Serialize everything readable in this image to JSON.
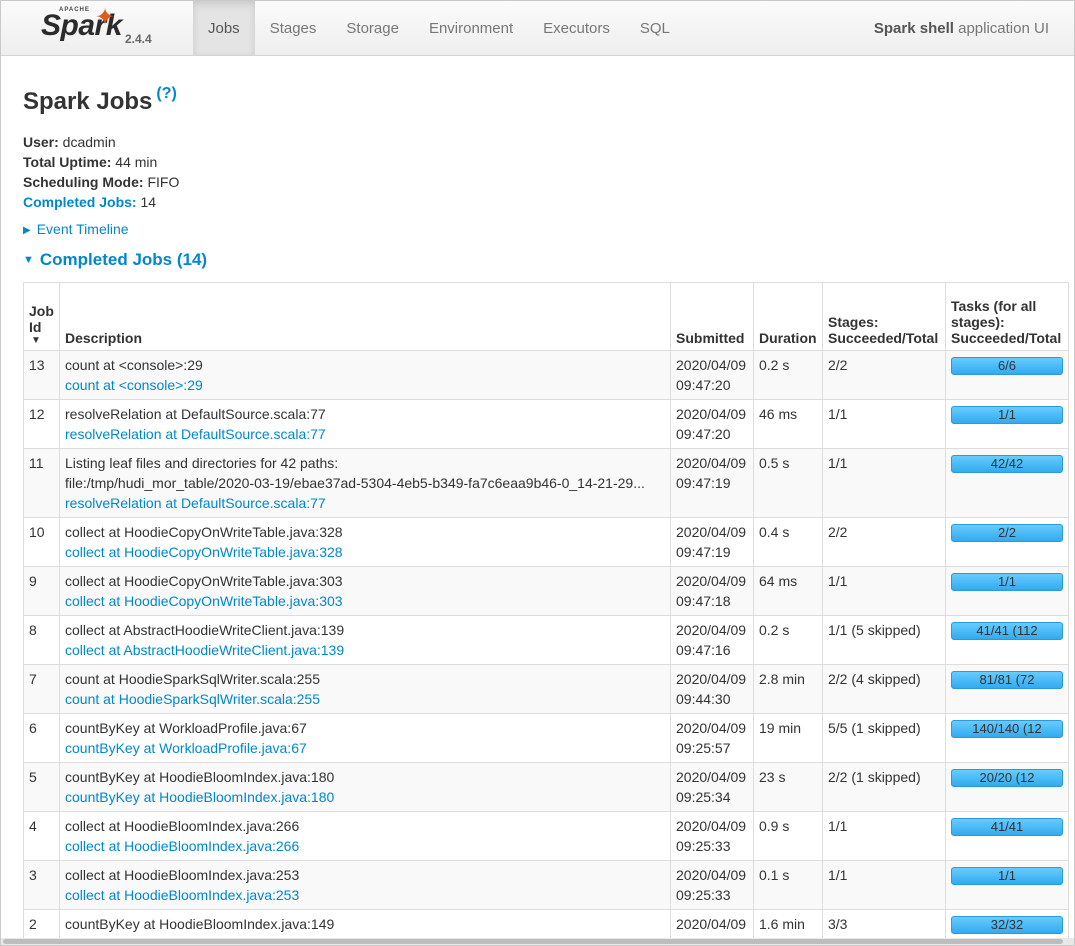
{
  "brand": {
    "apache": "APACHE",
    "name": "Spark",
    "version": "2.4.4"
  },
  "nav": {
    "tabs": [
      {
        "label": "Jobs",
        "active": true
      },
      {
        "label": "Stages",
        "active": false
      },
      {
        "label": "Storage",
        "active": false
      },
      {
        "label": "Environment",
        "active": false
      },
      {
        "label": "Executors",
        "active": false
      },
      {
        "label": "SQL",
        "active": false
      }
    ],
    "app_name_bold": "Spark shell",
    "app_name_rest": " application UI"
  },
  "page": {
    "title": "Spark Jobs",
    "help": "(?)",
    "user_label": "User:",
    "user": " dcadmin",
    "uptime_label": "Total Uptime:",
    "uptime": " 44 min",
    "mode_label": "Scheduling Mode:",
    "mode": " FIFO",
    "completed_label": "Completed Jobs:",
    "completed": " 14",
    "event_timeline": "Event Timeline",
    "completed_heading": "Completed Jobs (14)"
  },
  "table": {
    "headers": {
      "job_id": "Job Id",
      "description": "Description",
      "submitted": "Submitted",
      "duration": "Duration",
      "stages": "Stages: Succeeded/Total",
      "tasks": "Tasks (for all stages): Succeeded/Total"
    },
    "rows": [
      {
        "id": "13",
        "desc": "count at <console>:29",
        "link": "count at <console>:29",
        "submitted": "2020/04/09 09:47:20",
        "duration": "0.2 s",
        "stages": "2/2",
        "tasks": "6/6",
        "progress": 1.0
      },
      {
        "id": "12",
        "desc": "resolveRelation at DefaultSource.scala:77",
        "link": "resolveRelation at DefaultSource.scala:77",
        "submitted": "2020/04/09 09:47:20",
        "duration": "46 ms",
        "stages": "1/1",
        "tasks": "1/1",
        "progress": 1.0
      },
      {
        "id": "11",
        "desc": "Listing leaf files and directories for 42 paths:",
        "desc2": "file:/tmp/hudi_mor_table/2020-03-19/ebae37ad-5304-4eb5-b349-fa7c6eaa9b46-0_14-21-29...",
        "link": "resolveRelation at DefaultSource.scala:77",
        "submitted": "2020/04/09 09:47:19",
        "duration": "0.5 s",
        "stages": "1/1",
        "tasks": "42/42",
        "progress": 1.0
      },
      {
        "id": "10",
        "desc": "collect at HoodieCopyOnWriteTable.java:328",
        "link": "collect at HoodieCopyOnWriteTable.java:328",
        "submitted": "2020/04/09 09:47:19",
        "duration": "0.4 s",
        "stages": "2/2",
        "tasks": "2/2",
        "progress": 1.0
      },
      {
        "id": "9",
        "desc": "collect at HoodieCopyOnWriteTable.java:303",
        "link": "collect at HoodieCopyOnWriteTable.java:303",
        "submitted": "2020/04/09 09:47:18",
        "duration": "64 ms",
        "stages": "1/1",
        "tasks": "1/1",
        "progress": 1.0
      },
      {
        "id": "8",
        "desc": "collect at AbstractHoodieWriteClient.java:139",
        "link": "collect at AbstractHoodieWriteClient.java:139",
        "submitted": "2020/04/09 09:47:16",
        "duration": "0.2 s",
        "stages": "1/1 (5 skipped)",
        "tasks": "41/41 (112",
        "progress": 1.0
      },
      {
        "id": "7",
        "desc": "count at HoodieSparkSqlWriter.scala:255",
        "link": "count at HoodieSparkSqlWriter.scala:255",
        "submitted": "2020/04/09 09:44:30",
        "duration": "2.8 min",
        "stages": "2/2 (4 skipped)",
        "tasks": "81/81 (72",
        "progress": 1.0
      },
      {
        "id": "6",
        "desc": "countByKey at WorkloadProfile.java:67",
        "link": "countByKey at WorkloadProfile.java:67",
        "submitted": "2020/04/09 09:25:57",
        "duration": "19 min",
        "stages": "5/5 (1 skipped)",
        "tasks": "140/140 (12",
        "progress": 1.0
      },
      {
        "id": "5",
        "desc": "countByKey at HoodieBloomIndex.java:180",
        "link": "countByKey at HoodieBloomIndex.java:180",
        "submitted": "2020/04/09 09:25:34",
        "duration": "23 s",
        "stages": "2/2 (1 skipped)",
        "tasks": "20/20 (12",
        "progress": 1.0
      },
      {
        "id": "4",
        "desc": "collect at HoodieBloomIndex.java:266",
        "link": "collect at HoodieBloomIndex.java:266",
        "submitted": "2020/04/09 09:25:33",
        "duration": "0.9 s",
        "stages": "1/1",
        "tasks": "41/41",
        "progress": 1.0
      },
      {
        "id": "3",
        "desc": "collect at HoodieBloomIndex.java:253",
        "link": "collect at HoodieBloomIndex.java:253",
        "submitted": "2020/04/09 09:25:33",
        "duration": "0.1 s",
        "stages": "1/1",
        "tasks": "1/1",
        "progress": 1.0
      },
      {
        "id": "2",
        "desc": "countByKey at HoodieBloomIndex.java:149",
        "link": "",
        "submitted": "2020/04/09",
        "duration": "1.6 min",
        "stages": "3/3",
        "tasks": "32/32",
        "progress": 1.0
      }
    ]
  },
  "colors": {
    "accent": "#0088cc",
    "spark_orange": "#e25a1c",
    "progress": "#4db8f0"
  }
}
